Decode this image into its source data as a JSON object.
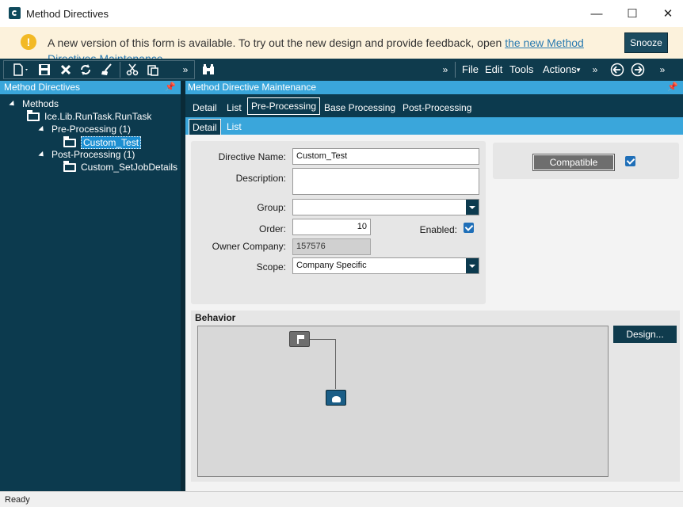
{
  "window": {
    "title": "Method Directives",
    "minimize": "—",
    "maximize": "☐",
    "close": "✕"
  },
  "notification": {
    "icon": "!",
    "text": "A new version of this form is available. To try out the new design and provide feedback, open ",
    "link": "the new Method Directives Maintenance",
    "snooze": "Snooze"
  },
  "toolbar": {
    "icons": [
      "new-doc-icon",
      "save-icon",
      "delete-icon",
      "refresh-icon",
      "clear-icon",
      "cut-icon",
      "paste-icon",
      "binoculars-icon",
      "back-icon",
      "forward-icon"
    ],
    "menu": {
      "file": "File",
      "edit": "Edit",
      "tools": "Tools",
      "actions": "Actions"
    },
    "overflow": "»"
  },
  "left_panel": {
    "title": "Method Directives",
    "tree": {
      "root": "Methods",
      "method": "Ice.Lib.RunTask.RunTask",
      "pre": "Pre-Processing (1)",
      "pre_child": "Custom_Test",
      "post": "Post-Processing (1)",
      "post_child": "Custom_SetJobDetails"
    }
  },
  "right_panel": {
    "title": "Method Directive Maintenance",
    "tabs": [
      "Detail",
      "List",
      "Pre-Processing",
      "Base Processing",
      "Post-Processing"
    ],
    "subtabs": [
      "Detail",
      "List"
    ]
  },
  "form": {
    "directive_name_label": "Directive Name:",
    "directive_name": "Custom_Test",
    "description_label": "Description:",
    "description": "",
    "group_label": "Group:",
    "group": "",
    "order_label": "Order:",
    "order": "10",
    "enabled_label": "Enabled:",
    "enabled": true,
    "owner_company_label": "Owner Company:",
    "owner_company": "157576",
    "scope_label": "Scope:",
    "scope": "Company Specific",
    "compatible_label": "Compatible",
    "compatible": true
  },
  "behavior": {
    "title": "Behavior",
    "design_button": "Design..."
  },
  "status": {
    "text": "Ready"
  },
  "colors": {
    "dark_teal": "#0c3a4e",
    "accent_blue": "#3aa6db",
    "notify_bg": "#fcf2dc"
  }
}
